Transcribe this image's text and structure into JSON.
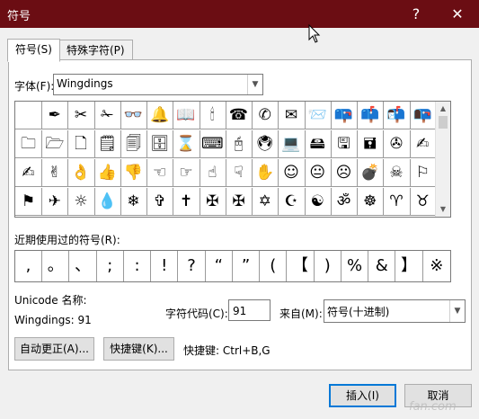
{
  "window": {
    "title": "符号",
    "help": "?",
    "close": "✕"
  },
  "tabs": [
    {
      "label": "符号(S)"
    },
    {
      "label": "特殊字符(P)"
    }
  ],
  "font": {
    "label": "字体(F):",
    "value": "Wingdings"
  },
  "grid": {
    "selected_index": 75,
    "symbols": [
      " ",
      "✒",
      "✂",
      "✁",
      "👓",
      "🔔",
      "📖",
      "🕯",
      "☎",
      "✆",
      "✉",
      "📨",
      "📪",
      "📫",
      "📬",
      "📭",
      "🗀",
      "🗁",
      "🗋",
      "🗒",
      "🗐",
      "🗄",
      "⌛",
      "⌨",
      "🖰",
      "🖲",
      "💻",
      "🖴",
      "🖫",
      "🖬",
      "✇",
      "✍",
      "✍",
      "✌",
      "👌",
      "👍",
      "👎",
      "☜",
      "☞",
      "☝",
      "☟",
      "✋",
      "☺",
      "😐",
      "☹",
      "💣",
      "☠",
      "⚐",
      "⚑",
      "✈",
      "☼",
      "💧",
      "❄",
      "✞",
      "✝",
      "✠",
      "✠",
      "✡",
      "☪",
      "☯",
      "ॐ",
      "☸",
      "♈",
      "♉"
    ]
  },
  "recent": {
    "label": "近期使用过的符号(R):",
    "symbols": [
      ",",
      "。",
      "、",
      ";",
      ":",
      "!",
      "?",
      "“",
      "”",
      "(",
      "【",
      ")",
      "%",
      "&",
      "】",
      "※"
    ]
  },
  "info": {
    "unicode_name_label": "Unicode 名称:",
    "unicode_name_value": "Wingdings: 91",
    "char_code_label": "字符代码(C):",
    "char_code_value": "91",
    "from_label": "来自(M):",
    "from_value": "符号(十进制)"
  },
  "buttons": {
    "autocorrect": "自动更正(A)...",
    "shortcut_key": "快捷键(K)...",
    "shortcut_text": "快捷键: Ctrl+B,G",
    "insert": "插入(I)",
    "cancel": "取消"
  },
  "colors": {
    "titlebar": "#6b0d13",
    "selection": "#0a6ad9"
  },
  "watermark": "fan.com"
}
